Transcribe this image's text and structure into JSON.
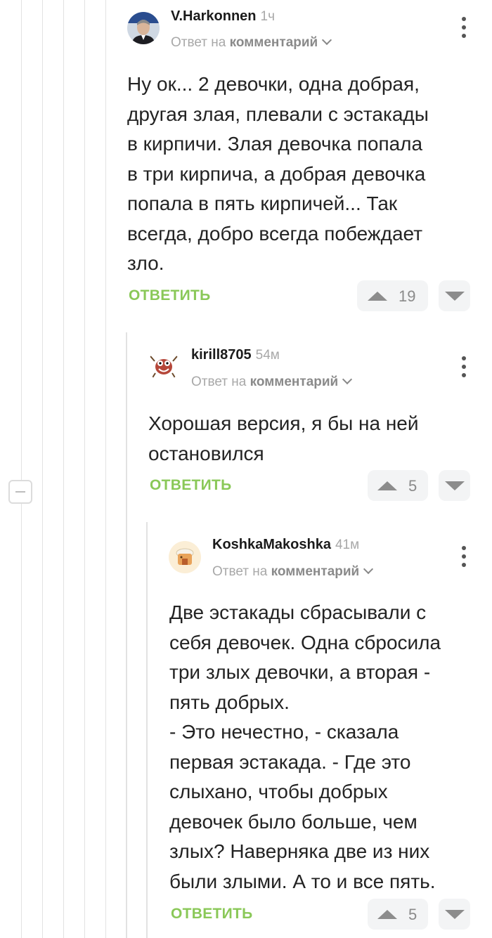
{
  "colors": {
    "accent": "#8ac858",
    "muted": "#a8a8a8",
    "vote_bg": "#f3f4f5"
  },
  "comments": [
    {
      "user": "V.Harkonnen",
      "time": "1ч",
      "reply_prefix": "Ответ на",
      "reply_target": "комментарий",
      "text": "Ну ок... 2 девочки, одна добрая,\nдругая злая, плевали с эстакады\nв кирпичи. Злая девочка попала\nв три кирпича, а добрая девочка\nпопала в пять кирпичей... Так\nвсегда, добро всегда побеждает\nзло.",
      "reply_label": "ОТВЕТИТЬ",
      "score": "19",
      "avatar_icon": "user-photo-avatar"
    },
    {
      "user": "kirill8705",
      "time": "54м",
      "reply_prefix": "Ответ на",
      "reply_target": "комментарий",
      "text": "Хорошая версия, я бы на ней\nостановился",
      "reply_label": "ОТВЕТИТЬ",
      "score": "5",
      "avatar_icon": "cartoon-avatar"
    },
    {
      "user": "KoshkaMakoshka",
      "time": "41м",
      "reply_prefix": "Ответ на",
      "reply_target": "комментарий",
      "text": "Две эстакады сбрасывали с\nсебя девочек. Одна сбросила\nтри злых девочки, а вторая -\nпять добрых.\n- Это нечестно, - сказала\nпервая эстакада. - Где это\nслыхано, чтобы добрых\nдевочек было больше, чем\nзлых? Наверняка две из них\nбыли злыми. А то и все пять.",
      "reply_label": "ОТВЕТИТЬ",
      "score": "5",
      "avatar_icon": "cat-hat-avatar"
    }
  ]
}
